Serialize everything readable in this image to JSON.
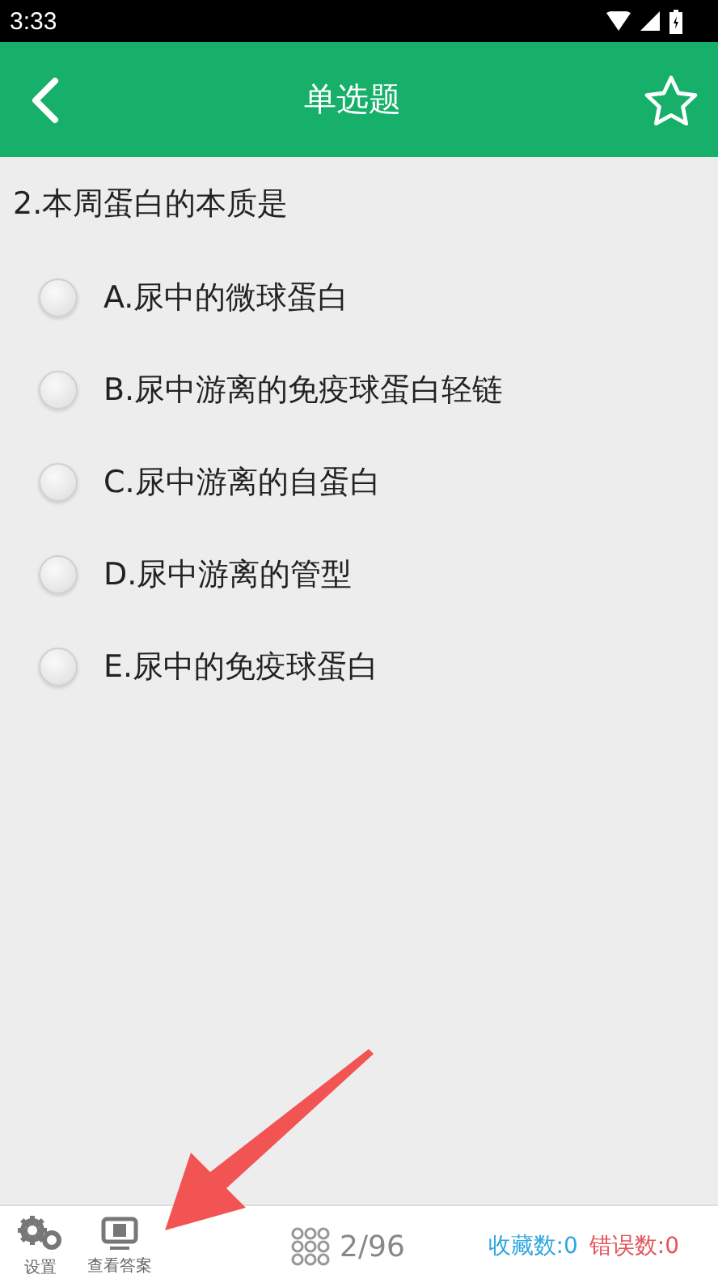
{
  "status_bar": {
    "time": "3:33"
  },
  "header": {
    "title": "单选题",
    "favorited": false
  },
  "question": {
    "text": "2.本周蛋白的本质是"
  },
  "options": [
    {
      "label": "A.尿中的微球蛋白",
      "selected": false
    },
    {
      "label": "B.尿中游离的免疫球蛋白轻链",
      "selected": false
    },
    {
      "label": "C.尿中游离的自蛋白",
      "selected": false
    },
    {
      "label": "D.尿中游离的管型",
      "selected": false
    },
    {
      "label": "E.尿中的免疫球蛋白",
      "selected": false
    }
  ],
  "bottom_bar": {
    "settings": "设置",
    "answer": "查看答案",
    "progress": "2/96",
    "favorites": "收藏数:0",
    "errors": "错误数:0"
  }
}
